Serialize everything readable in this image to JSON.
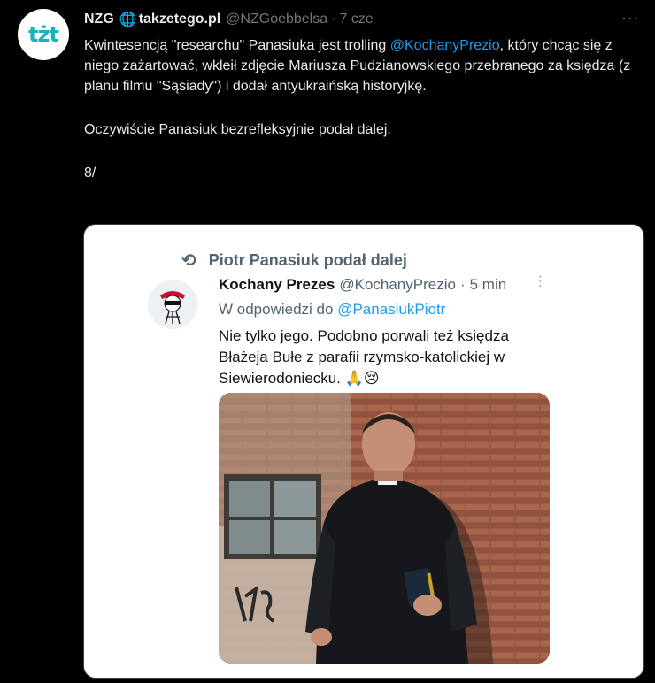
{
  "tweet": {
    "author_name": "NZG",
    "author_site": "takzetego.pl",
    "handle": "@NZGoebbelsa",
    "separator": "·",
    "time": "7 cze",
    "avatar_text": "tżt",
    "more_label": "···",
    "line1_pre": "Kwintesencją \"researchu\" Panasiuka jest trolling ",
    "line1_mention": "@KochanyPrezio",
    "line1_post": ", który chcąc się z niego zażartować, wkleił zdjęcie Mariusza Pudzianowskiego przebranego za księdza (z planu filmu \"Sąsiady\") i dodał antyukraińską historyjkę.",
    "paragraph2": "Oczywiście Panasiuk bezrefleksyjnie podał dalej.",
    "paragraph3": "8/"
  },
  "embedded": {
    "retweet_label": "Piotr Panasiuk podał dalej",
    "retweet_icon": "retweet-icon",
    "name": "Kochany Prezes",
    "handle": "@KochanyPrezio",
    "separator": "·",
    "time": "5 min",
    "more_label": "···",
    "reply_prefix": "W odpowiedzi do ",
    "reply_mention": "@PanasiukPiotr",
    "text": "Nie tylko jego. Podobno porwali też księdza Błażeja Bułe z parafii rzymsko-katolickiej w Siewierodoniecku. 🙏😢"
  },
  "colors": {
    "background": "#000000",
    "text": "#e7e9ea",
    "muted": "#71767b",
    "link": "#1d9bf0",
    "avatar_accent": "#17b3c1"
  }
}
